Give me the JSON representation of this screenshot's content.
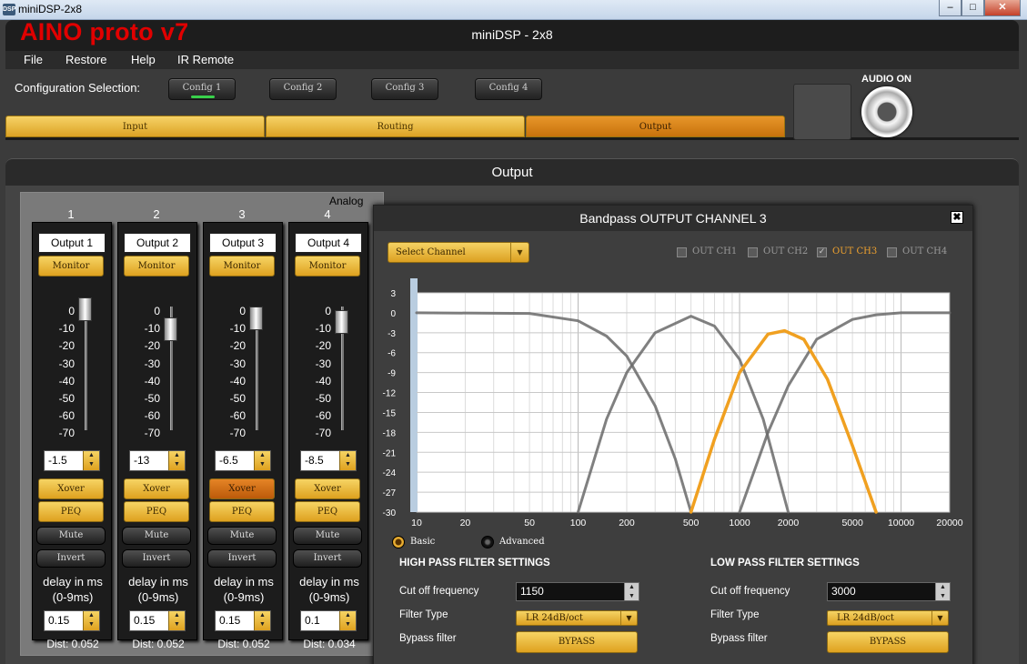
{
  "os": {
    "window_title": "miniDSP-2x8",
    "logo_text": "DSP"
  },
  "app": {
    "brand": "AINO proto v7",
    "title": "miniDSP - 2x8",
    "menu": [
      "File",
      "Restore",
      "Help",
      "IR Remote"
    ],
    "config_label": "Configuration Selection:",
    "configs": [
      "Config 1",
      "Config 2",
      "Config 3",
      "Config 4"
    ],
    "active_config": "Config 1",
    "tabs": [
      "Input",
      "Routing",
      "Output"
    ],
    "active_tab": "Output",
    "audio_label": "AUDIO ON",
    "brand_color": "#e10000",
    "accent_color": "#f0b43a"
  },
  "output_panel": {
    "title": "Output",
    "analog_label": "Analog",
    "fader_scale": [
      "0",
      "-10",
      "-20",
      "-30",
      "-40",
      "-50",
      "-60",
      "-70"
    ],
    "monitor_label": "Monitor",
    "xover_label": "Xover",
    "peq_label": "PEQ",
    "mute_label": "Mute",
    "invert_label": "Invert",
    "delay_label_line1": "delay in ms",
    "delay_label_line2": "(0-9ms)",
    "channels": [
      {
        "number": "1",
        "name": "Output 1",
        "gain": "-1.5",
        "fader_db": -1.5,
        "delay": "0.15",
        "dist": "Dist: 0.052",
        "xover_active": false
      },
      {
        "number": "2",
        "name": "Output 2",
        "gain": "-13",
        "fader_db": -13,
        "delay": "0.15",
        "dist": "Dist: 0.052",
        "xover_active": false
      },
      {
        "number": "3",
        "name": "Output 3",
        "gain": "-6.5",
        "fader_db": -6.5,
        "delay": "0.15",
        "dist": "Dist: 0.052",
        "xover_active": true
      },
      {
        "number": "4",
        "name": "Output 4",
        "gain": "-8.5",
        "fader_db": -8.5,
        "delay": "0.1",
        "dist": "Dist: 0.034",
        "xover_active": false
      }
    ]
  },
  "bandpass": {
    "title": "Bandpass OUTPUT CHANNEL 3",
    "close_symbol": "✖",
    "select_channel": "Select Channel",
    "out_channels": [
      {
        "label": "OUT CH1",
        "checked": false
      },
      {
        "label": "OUT CH2",
        "checked": false
      },
      {
        "label": "OUT CH3",
        "checked": true
      },
      {
        "label": "OUT CH4",
        "checked": false
      }
    ],
    "modes": [
      {
        "label": "Basic",
        "selected": true
      },
      {
        "label": "Advanced",
        "selected": false
      }
    ],
    "high_pass": {
      "heading": "HIGH PASS FILTER SETTINGS",
      "cutoff_label": "Cut off frequency",
      "cutoff": "1150",
      "type_label": "Filter Type",
      "type": "LR 24dB/oct",
      "bypass_label": "Bypass filter",
      "bypass_button": "BYPASS"
    },
    "low_pass": {
      "heading": "LOW PASS FILTER SETTINGS",
      "cutoff_label": "Cut off frequency",
      "cutoff": "3000",
      "type_label": "Filter Type",
      "type": "LR 24dB/oct",
      "bypass_label": "Bypass filter",
      "bypass_button": "BYPASS"
    }
  },
  "chart_data": {
    "type": "line",
    "x_scale": "log",
    "xlim": [
      10,
      20000
    ],
    "ylim": [
      -30,
      3
    ],
    "x_ticks": [
      "10",
      "20",
      "50",
      "100",
      "200",
      "500",
      "1000",
      "2000",
      "5000",
      "10000",
      "20000"
    ],
    "y_ticks": [
      "3",
      "0",
      "-3",
      "-6",
      "-9",
      "-12",
      "-15",
      "-18",
      "-21",
      "-24",
      "-27",
      "-30"
    ],
    "grid": true,
    "series": [
      {
        "channel": "OUT CH1",
        "color": "#6a6a6a",
        "highlighted": false,
        "x": [
          10,
          50,
          100,
          150,
          200,
          300,
          400,
          500
        ],
        "y": [
          0,
          -0.1,
          -1.2,
          -3.5,
          -6.5,
          -14,
          -22,
          -30
        ]
      },
      {
        "channel": "OUT CH2",
        "color": "#6a6a6a",
        "highlighted": false,
        "x": [
          100,
          150,
          200,
          300,
          500,
          700,
          1000,
          1400,
          2000
        ],
        "y": [
          -30,
          -16,
          -9,
          -3,
          -0.5,
          -2,
          -7,
          -16,
          -30
        ]
      },
      {
        "channel": "OUT CH3",
        "color": "#f0a020",
        "highlighted": true,
        "x": [
          500,
          700,
          1000,
          1500,
          1900,
          2500,
          3500,
          5000,
          7000
        ],
        "y": [
          -30,
          -19,
          -9,
          -3.2,
          -2.7,
          -4,
          -10,
          -20,
          -30
        ]
      },
      {
        "channel": "OUT CH4",
        "color": "#6a6a6a",
        "highlighted": false,
        "x": [
          1000,
          1500,
          2000,
          3000,
          5000,
          7000,
          10000,
          20000
        ],
        "y": [
          -30,
          -18,
          -11,
          -4,
          -1,
          -0.3,
          0,
          0
        ]
      }
    ]
  }
}
